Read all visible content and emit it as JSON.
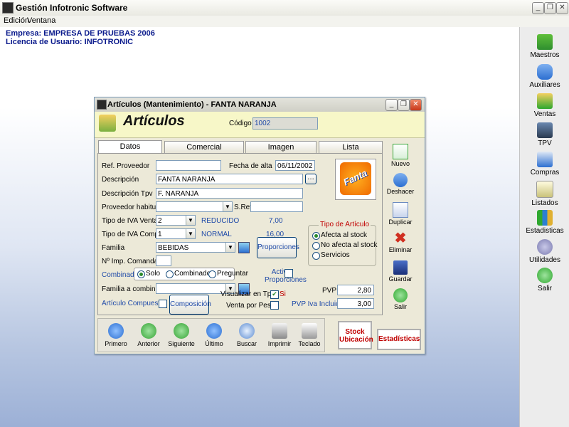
{
  "app": {
    "title": "Gestión Infotronic Software",
    "menu": [
      "Edición",
      "Ventana"
    ],
    "company_line1": "Empresa: EMPRESA DE PRUEBAS   2006",
    "company_line2": "Licencia de Usuario: INFOTRONIC",
    "window_buttons": [
      "_",
      "❐",
      "✕"
    ]
  },
  "rightbar": {
    "items": [
      {
        "label": "Maestros",
        "icon": "books-icon",
        "color": "#2f8f2f"
      },
      {
        "label": "Auxiliares",
        "icon": "database-icon",
        "color": "#2c6fd1"
      },
      {
        "label": "Ventas",
        "icon": "money-icon",
        "color": "#d8a61a"
      },
      {
        "label": "TPV",
        "icon": "computer-icon",
        "color": "#3a4c66"
      },
      {
        "label": "Compras",
        "icon": "shopping-bag-icon",
        "color": "#2c6fd1"
      },
      {
        "label": "Listados",
        "icon": "list-document-icon",
        "color": "#7a8a3a"
      },
      {
        "label": "Estadisticas",
        "icon": "bar-chart-icon",
        "color": "#2c7fd1"
      },
      {
        "label": "Utilidades",
        "icon": "gears-icon",
        "color": "#7b7bb0"
      },
      {
        "label": "Salir",
        "icon": "running-man-icon",
        "color": "#2fa82f"
      }
    ]
  },
  "window": {
    "title": "Artículos (Mantenimiento) - FANTA NARANJA",
    "header_title": "Artículos",
    "codigo_label": "Código",
    "codigo_value": "1002",
    "tabs": [
      "Datos",
      "Comercial",
      "Imagen",
      "Lista"
    ],
    "fields": {
      "ref_proveedor_label": "Ref. Proveedor",
      "ref_proveedor": "",
      "fecha_alta_label": "Fecha de alta",
      "fecha_alta": "06/11/2002",
      "descripcion_label": "Descripción",
      "descripcion": "FANTA NARANJA",
      "descripcion_tpv_label": "Descripción Tpv",
      "descripcion_tpv": "F. NARANJA",
      "proveedor_habitual_label": "Proveedor habitual",
      "proveedor_habitual": "",
      "sref_label": "S.Ref",
      "sref": "",
      "iva_venta_label": "Tipo de IVA Venta",
      "iva_venta": "2",
      "iva_venta_name": "REDUCIDO",
      "iva_venta_pct": "7,00",
      "iva_compra_label": "Tipo de IVA Compra",
      "iva_compra": "1",
      "iva_compra_name": "NORMAL",
      "iva_compra_pct": "16,00",
      "familia_label": "Familia",
      "familia": "BEBIDAS",
      "imp_comandas_label": "Nº Imp. Comandas",
      "imp_comandas": "",
      "combinado_label": "Combinado",
      "combinado_options": [
        "Solo",
        "Combinado",
        "Preguntar"
      ],
      "familia_combinar_label": "Familia a combinar",
      "familia_combinar": "",
      "articulo_compuesto_label": "Artículo Compuesto",
      "composicion_button": "Composición",
      "proporciones_button": "Proporciones",
      "activar_proporciones_label": "Activar Proporciones",
      "tipo_articulo_label": "Tipo de Artículo",
      "tipo_articulo_options": [
        "Afecta al stock",
        "No afecta al stock",
        "Servicios"
      ],
      "visualizar_tpv_label": "Visualizar en Tpv",
      "visualizar_tpv_value": "Si",
      "venta_peso_label": "Venta por Peso",
      "pvp_label": "PVP",
      "pvp": "2,80",
      "pvp_iva_label": "PVP Iva Incluido",
      "pvp_iva": "3,00",
      "product_image_text": "Fanta"
    },
    "side_buttons": [
      {
        "label": "Nuevo",
        "icon": "new-document-icon",
        "color": "#3aa63a"
      },
      {
        "label": "Deshacer",
        "icon": "undo-icon",
        "color": "#2c6fd1"
      },
      {
        "label": "Duplicar",
        "icon": "duplicate-icon",
        "color": "#6a8ac0"
      },
      {
        "label": "Eliminar",
        "icon": "delete-x-icon",
        "color": "#d03020"
      },
      {
        "label": "Guardar",
        "icon": "save-disk-icon",
        "color": "#2a4fa8"
      },
      {
        "label": "Salir",
        "icon": "running-man-icon",
        "color": "#2fa82f"
      }
    ],
    "nav_buttons": [
      {
        "label": "Primero",
        "icon": "arrow-first-icon",
        "color": "#2c6fd1"
      },
      {
        "label": "Anterior",
        "icon": "arrow-left-icon",
        "color": "#35a335"
      },
      {
        "label": "Siguiente",
        "icon": "arrow-right-icon",
        "color": "#35a335"
      },
      {
        "label": "Último",
        "icon": "arrow-last-icon",
        "color": "#2c6fd1"
      },
      {
        "label": "Buscar",
        "icon": "magnifier-icon",
        "color": "#5a8ad0"
      },
      {
        "label": "Imprimir",
        "icon": "printer-icon",
        "color": "#8a8a8a"
      },
      {
        "label": "Teclado",
        "icon": "keyboard-icon",
        "color": "#9a9a9a"
      }
    ],
    "stock_button": "Stock Ubicación",
    "estadisticas_button": "Estadísticas"
  }
}
